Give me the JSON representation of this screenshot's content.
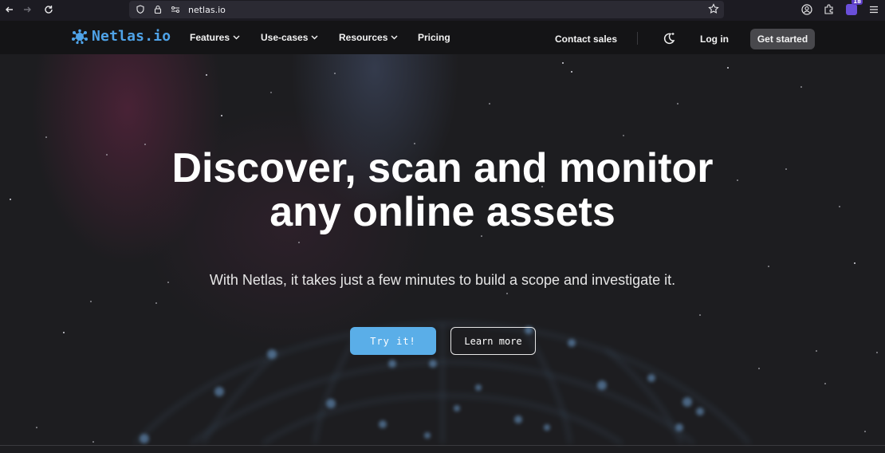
{
  "browser": {
    "url": "netlas.io",
    "extension_badge": "18"
  },
  "site": {
    "logo_text": "Netlas.io",
    "menu": [
      {
        "label": "Features"
      },
      {
        "label": "Use-cases"
      },
      {
        "label": "Resources"
      },
      {
        "label": "Pricing"
      }
    ],
    "contact_sales": "Contact sales",
    "login": "Log in",
    "get_started": "Get started"
  },
  "hero": {
    "headline_line1": "Discover, scan and monitor",
    "headline_line2": "any online assets",
    "subtitle": "With Netlas, it takes just a few minutes to build a scope and investigate it.",
    "primary_button": "Try it!",
    "secondary_button": "Learn more"
  },
  "icons": {
    "back": "arrow-left-icon",
    "forward": "arrow-right-icon",
    "reload": "reload-icon",
    "shield": "shield-icon",
    "lock": "lock-icon",
    "permissions": "permissions-icon",
    "bookmark": "star-icon",
    "theme": "moon-icon",
    "menu": "hamburger-icon"
  },
  "colors": {
    "accent": "#5aaee8",
    "logo": "#4fa3e8",
    "background": "#1d1d20",
    "nav_background": "#141416",
    "button_dark": "#48484c"
  }
}
